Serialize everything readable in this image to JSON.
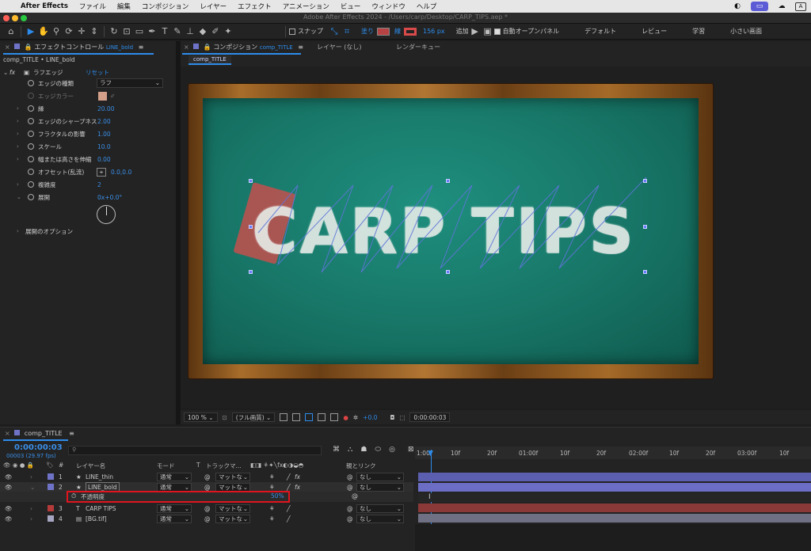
{
  "menubar": {
    "app_name": "After Effects",
    "items": [
      "ファイル",
      "編集",
      "コンポジション",
      "レイヤー",
      "エフェクト",
      "アニメーション",
      "ビュー",
      "ウィンドウ",
      "ヘルプ"
    ],
    "tray_a": "A"
  },
  "window": {
    "title": "Adobe After Effects 2024 - /Users/carp/Desktop/CARP_TIPS.aep *"
  },
  "toolbar": {
    "snap_label": "スナップ",
    "fill_label": "塗り",
    "stroke_label": "線",
    "stroke_width": "156 px",
    "add_label": "追加",
    "auto_open_label": "自動オープンパネル",
    "workspaces": [
      "デフォルト",
      "レビュー",
      "学習",
      "小さい画面"
    ]
  },
  "effect_panel": {
    "tab_label": "エフェクトコントロール",
    "tab_layer": "LINE_bold",
    "breadcrumb": "comp_TITLE • LINE_bold",
    "effect_name": "ラフエッジ",
    "reset_label": "リセット",
    "rows": [
      {
        "label": "エッジの種類",
        "value": "ラフ"
      },
      {
        "label": "エッジカラー",
        "value": ""
      },
      {
        "label": "縁",
        "value": "20.00"
      },
      {
        "label": "エッジのシャープネス",
        "value": "2.00"
      },
      {
        "label": "フラクタルの影響",
        "value": "1.00"
      },
      {
        "label": "スケール",
        "value": "10.0"
      },
      {
        "label": "幅または高さを伸縮",
        "value": "0.00"
      },
      {
        "label": "オフセット(乱流)",
        "value": "0.0,0.0"
      },
      {
        "label": "複雑度",
        "value": "2"
      },
      {
        "label": "展開",
        "value": "0x+0.0°"
      }
    ],
    "options_label": "展開のオプション",
    "edge_color": "#d4a08a"
  },
  "comp_panel": {
    "tab_label": "コンポジション",
    "tab_comp": "comp_TITLE",
    "tab_layer": "レイヤー (なし)",
    "tab_render": "レンダーキュー",
    "sub_tab": "comp_TITLE",
    "chalk_text": "CARP TIPS",
    "zoom": "100 %",
    "resolution": "(フル画質)",
    "exposure": "+0.0",
    "timecode": "0:00:00:03"
  },
  "timeline": {
    "comp_tab": "comp_TITLE",
    "current_time": "0:00:00:03",
    "frames_fps": "00003 (29.97 fps)",
    "search_placeholder": "",
    "col_layer_name": "レイヤー名",
    "col_mode": "モード",
    "col_t": "T",
    "col_track": "トラックマ...",
    "col_parent": "親とリンク",
    "ruler": [
      "1:00f",
      "10f",
      "20f",
      "01:00f",
      "10f",
      "20f",
      "02:00f",
      "10f",
      "20f",
      "03:00f",
      "10f"
    ],
    "layers": [
      {
        "num": "1",
        "name": "LINE_thin",
        "mode": "通常",
        "track": "マットな",
        "parent": "なし",
        "color": "#6f73c7"
      },
      {
        "num": "2",
        "name": "LINE_bold",
        "mode": "通常",
        "track": "マットな",
        "parent": "なし",
        "color": "#6f73c7"
      },
      {
        "num": "3",
        "name": "CARP TIPS",
        "mode": "通常",
        "track": "マットな",
        "parent": "なし",
        "color": "#b53a3a"
      },
      {
        "num": "4",
        "name": "[BG.tif]",
        "mode": "通常",
        "track": "マットな",
        "parent": "なし",
        "color": "#a6a6c2"
      }
    ],
    "property_row": {
      "label": "不透明度",
      "value": "50%"
    }
  }
}
